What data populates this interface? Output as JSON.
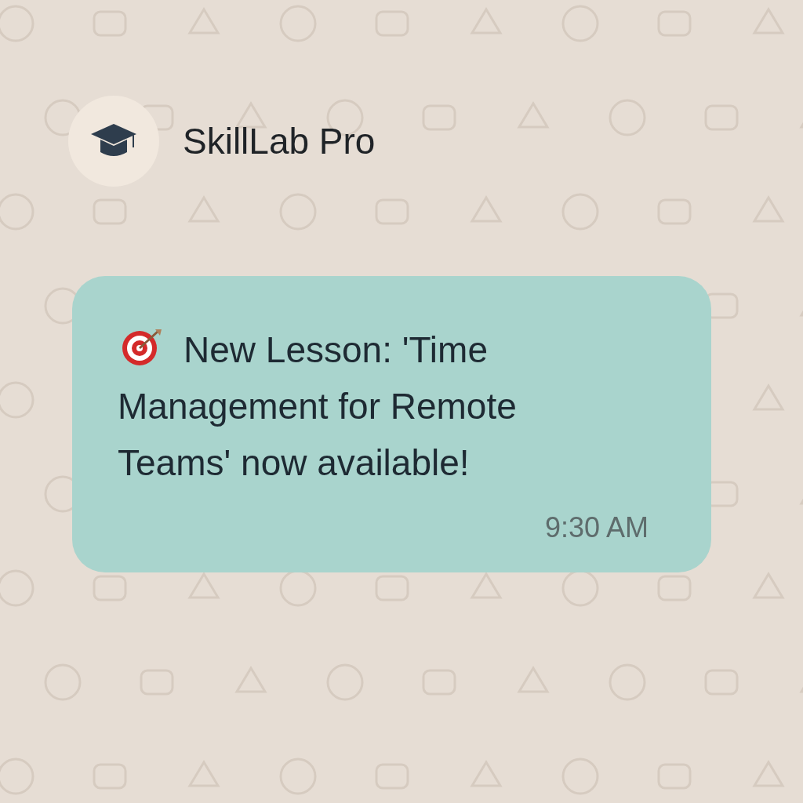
{
  "contact": {
    "name": "SkillLab Pro"
  },
  "message": {
    "text": "New Lesson: 'Time Management for Remote Teams' now available!",
    "time": "9:30 AM"
  }
}
